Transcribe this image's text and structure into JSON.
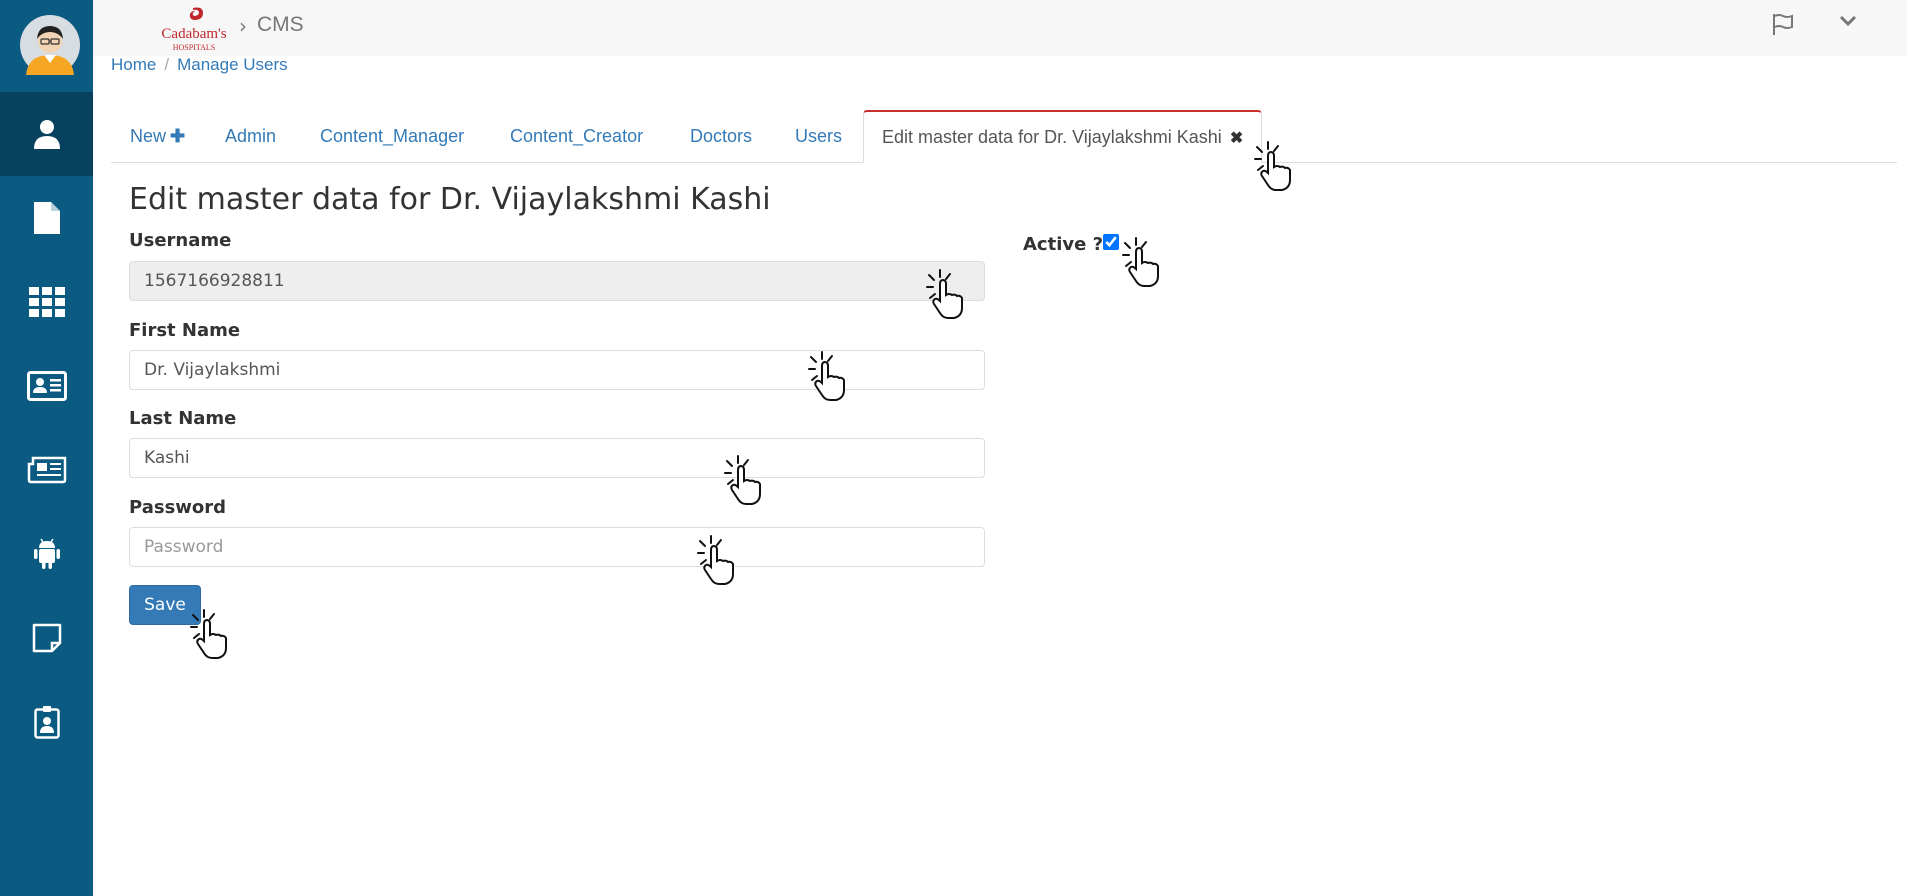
{
  "header": {
    "brand_name": "Cadabam's",
    "brand_sub": "HOSPITALS",
    "separator": "›",
    "app_name": "CMS"
  },
  "sidebar": {
    "items": [
      {
        "icon": "user-icon",
        "active": true
      },
      {
        "icon": "document-icon"
      },
      {
        "icon": "grid-icon"
      },
      {
        "icon": "id-card-icon"
      },
      {
        "icon": "newspaper-icon"
      },
      {
        "icon": "android-icon"
      },
      {
        "icon": "sticky-note-icon"
      },
      {
        "icon": "badge-icon"
      }
    ]
  },
  "breadcrumb": {
    "home": "Home",
    "separator": "/",
    "current": "Manage Users"
  },
  "tabs": [
    {
      "label": "New"
    },
    {
      "label": "Admin"
    },
    {
      "label": "Content_Manager"
    },
    {
      "label": "Content_Creator"
    },
    {
      "label": "Doctors"
    },
    {
      "label": "Users"
    },
    {
      "label": "Edit master data for Dr. Vijaylakshmi Kashi",
      "active": true
    }
  ],
  "form": {
    "title": "Edit master data for Dr. Vijaylakshmi Kashi",
    "username": {
      "label": "Username",
      "value": "1567166928811"
    },
    "first_name": {
      "label": "First Name",
      "value": "Dr. Vijaylakshmi"
    },
    "last_name": {
      "label": "Last Name",
      "value": "Kashi"
    },
    "password": {
      "label": "Password",
      "value": "",
      "placeholder": "Password"
    },
    "active": {
      "label": "Active ?",
      "checked": true
    },
    "save_label": "Save"
  },
  "colors": {
    "sidebar": "#0b5a82",
    "sidebar_active": "#07415e",
    "link": "#337ab7",
    "primary_button": "#337ab7",
    "active_tab_border": "#c9302c"
  }
}
